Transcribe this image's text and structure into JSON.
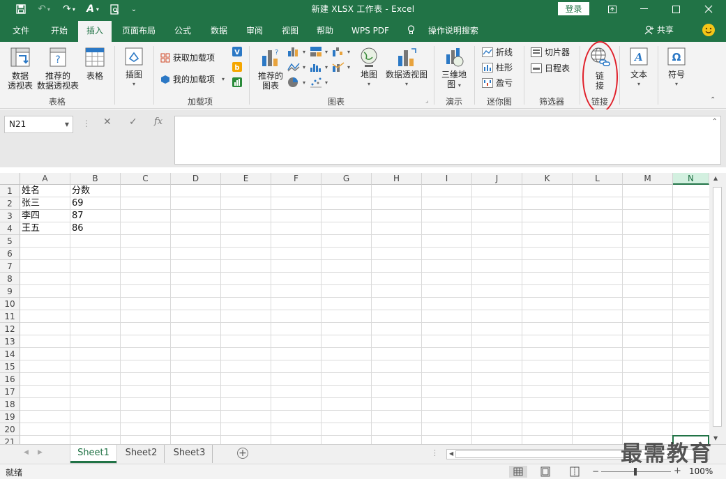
{
  "window": {
    "title": "新建 XLSX 工作表  -  Excel",
    "login_label": "登录"
  },
  "tabs": [
    "文件",
    "开始",
    "插入",
    "页面布局",
    "公式",
    "数据",
    "审阅",
    "视图",
    "帮助",
    "WPS PDF",
    "操作说明搜索"
  ],
  "active_tab": "插入",
  "share_label": "共享",
  "ribbon": {
    "groups": {
      "table": "表格",
      "addins": "加载项",
      "charts": "图表",
      "tours": "演示",
      "sparklines": "迷你图",
      "filters": "筛选器",
      "links": "链接"
    },
    "buttons": {
      "pivot_line1": "数据",
      "pivot_line2": "透视表",
      "rec_pivot_line1": "推荐的",
      "rec_pivot_line2": "数据透视表",
      "table": "表格",
      "illustrations": "插图",
      "get_addins": "获取加载项",
      "my_addins": "我的加载项",
      "rec_charts_line1": "推荐的",
      "rec_charts_line2": "图表",
      "maps": "地图",
      "pivot_chart": "数据透视图",
      "map3d_line1": "三维地",
      "map3d_line2": "图",
      "spark_line": "折线",
      "spark_column": "柱形",
      "spark_winloss": "盈亏",
      "slicer": "切片器",
      "timeline": "日程表",
      "link_line1": "链",
      "link_line2": "接",
      "text": "文本",
      "symbols": "符号"
    }
  },
  "formula_bar": {
    "name_box": "N21",
    "fx_label": "fx",
    "formula": ""
  },
  "sheet": {
    "columns": [
      "A",
      "B",
      "C",
      "D",
      "E",
      "F",
      "G",
      "H",
      "I",
      "J",
      "K",
      "L",
      "M",
      "N"
    ],
    "selected_column": "N",
    "rows": [
      "1",
      "2",
      "3",
      "4",
      "5",
      "6",
      "7",
      "8",
      "9",
      "10",
      "11",
      "12",
      "13",
      "14",
      "15",
      "16",
      "17",
      "18",
      "19",
      "20",
      "21"
    ],
    "data": [
      [
        "姓名",
        "分数"
      ],
      [
        "张三",
        "69"
      ],
      [
        "李四",
        "87"
      ],
      [
        "王五",
        "86"
      ]
    ]
  },
  "sheet_tabs": [
    "Sheet1",
    "Sheet2",
    "Sheet3"
  ],
  "active_sheet": "Sheet1",
  "status": {
    "ready": "就绪",
    "zoom": "100%"
  },
  "watermark": "最需教育",
  "colors": {
    "brand": "#217346",
    "highlight_circle": "#e0202a"
  }
}
